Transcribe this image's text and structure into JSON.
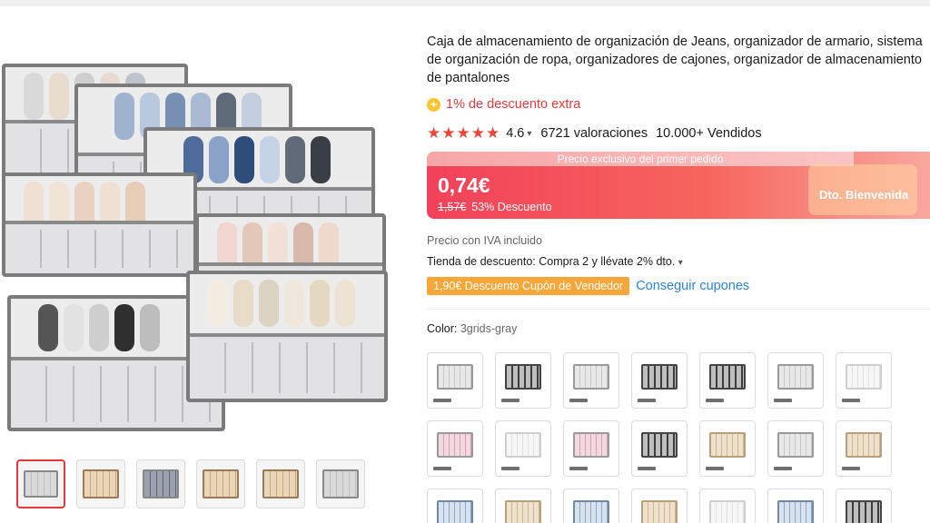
{
  "product": {
    "title": "Caja de almacenamiento de organización de Jeans, organizador de armario, sistema de organización de ropa, organizadores de cajones, organizador de almacenamiento de pantalones",
    "extra_discount": "1% de descuento extra",
    "rating": "4.6",
    "reviews": "6721 valoraciones",
    "sold": "10.000+ Vendidos",
    "stars": 5
  },
  "price": {
    "banner": "Precio exclusivo del primer pedido",
    "current": "0,74€",
    "original": "1,57€",
    "discount": "53% Descuento",
    "welcome": "Dto. Bienvenida"
  },
  "details": {
    "vat": "Precio con IVA incluido",
    "store_discount": "Tienda de descuento: Compra 2 y llévate 2% dto.",
    "coupon": "1,90€ Descuento Cupón de Vendedor",
    "get_coupons": "Conseguir cupones",
    "color_label": "Color:",
    "color_value": "3grids-gray"
  },
  "colors": {
    "accent_red": "#e4393c",
    "link_blue": "#2b85d6",
    "coupon_orange": "#f7a73a"
  }
}
